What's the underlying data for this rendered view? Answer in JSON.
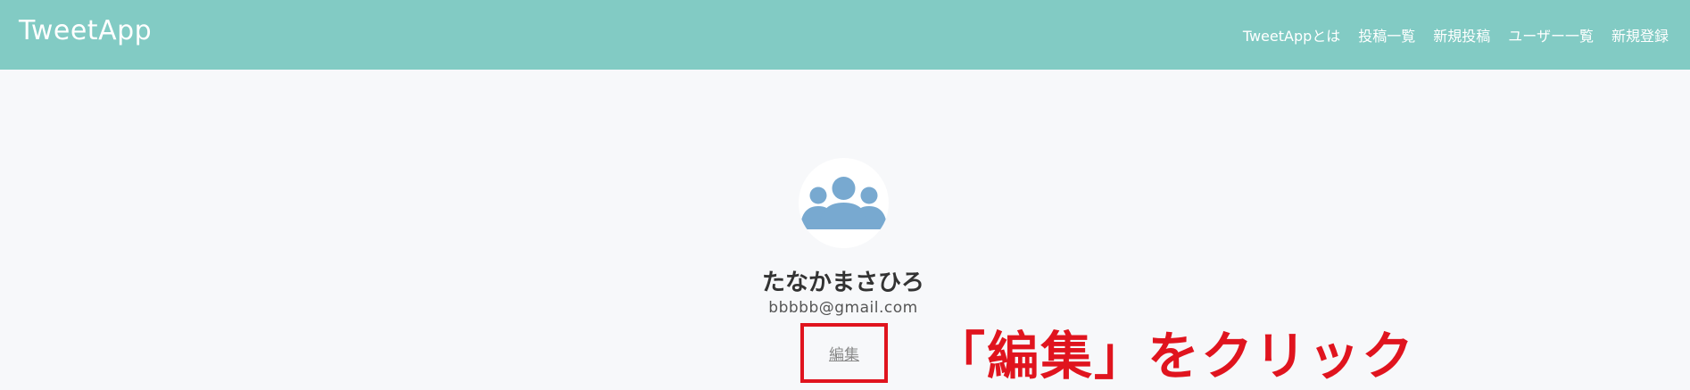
{
  "header": {
    "logo": "TweetApp",
    "nav": [
      {
        "label": "TweetAppとは"
      },
      {
        "label": "投稿一覧"
      },
      {
        "label": "新規投稿"
      },
      {
        "label": "ユーザー一覧"
      },
      {
        "label": "新規登録"
      }
    ]
  },
  "profile": {
    "avatar_icon": "users-group-icon",
    "name": "たなかまさひろ",
    "email": "bbbbb@gmail.com",
    "edit_label": "編集"
  },
  "annotation": {
    "text": "「編集」をクリック",
    "color": "#e0141e"
  },
  "colors": {
    "header_bg": "#82cbc4",
    "page_bg": "#f7f8fa",
    "avatar_fill": "#78a9d0"
  }
}
